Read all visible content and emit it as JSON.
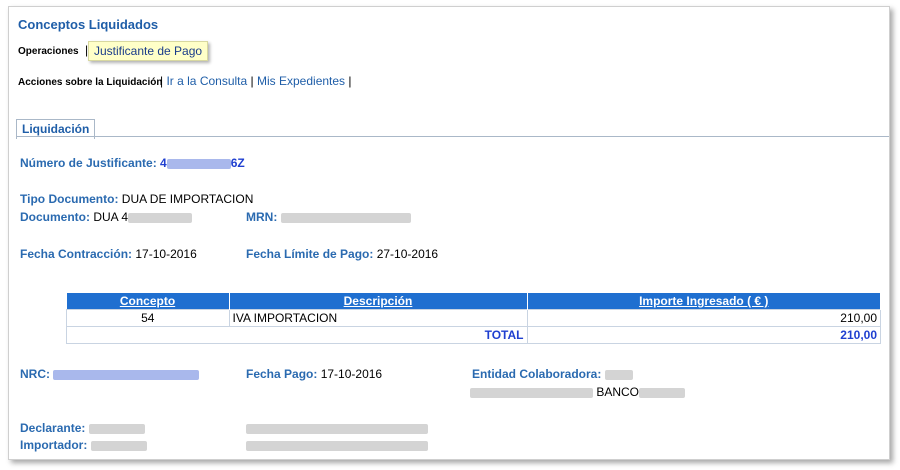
{
  "title": "Conceptos Liquidados",
  "operaciones": {
    "label": "Operaciones",
    "separator": "|",
    "button_label": "Justificante de Pago"
  },
  "acciones": {
    "label": "Acciones sobre la Liquidación",
    "links": [
      "Ir a la Consulta",
      "Mis Expedientes"
    ],
    "separator": "|"
  },
  "tab": {
    "label": "Liquidación"
  },
  "justificante": {
    "label": "Número de Justificante:",
    "prefix": "4",
    "suffix": "6Z"
  },
  "tipo_documento": {
    "label": "Tipo Documento:",
    "value": "DUA DE IMPORTACION"
  },
  "documento": {
    "label": "Documento:",
    "prefix": "DUA 4"
  },
  "mrn": {
    "label": "MRN:"
  },
  "fecha_contraccion": {
    "label": "Fecha Contracción:",
    "value": "17-10-2016"
  },
  "fecha_limite": {
    "label": "Fecha Límite de Pago:",
    "value": "27-10-2016"
  },
  "table": {
    "headers": [
      "Concepto",
      "Descripción",
      "Importe Ingresado ( € )"
    ],
    "rows": [
      {
        "concepto": "54",
        "descripcion": "IVA IMPORTACION",
        "importe": "210,00"
      }
    ],
    "total_label": "TOTAL",
    "total_value": "210,00"
  },
  "nrc": {
    "label": "NRC:"
  },
  "fecha_pago": {
    "label": "Fecha Pago:",
    "value": "17-10-2016"
  },
  "entidad": {
    "label": "Entidad Colaboradora:",
    "banco": "BANCO"
  },
  "declarante": {
    "label": "Declarante:"
  },
  "importador": {
    "label": "Importador:"
  },
  "colors": {
    "link": "#1f5ea8",
    "table_header": "#1f6fd0",
    "button_bg": "#ffffc8"
  }
}
